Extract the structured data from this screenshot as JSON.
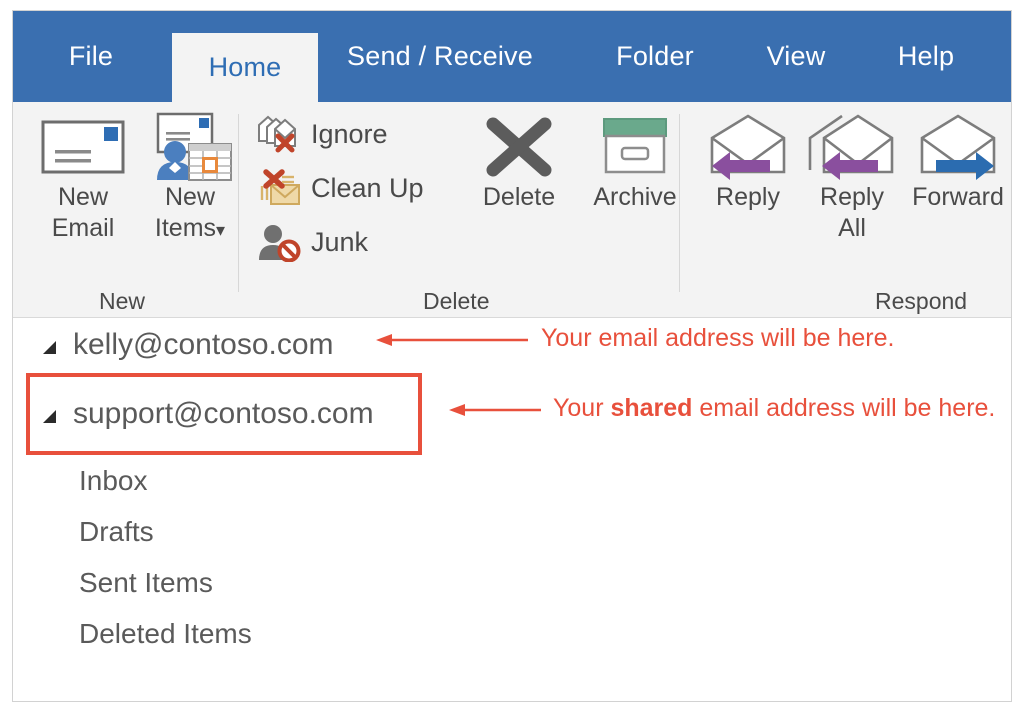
{
  "window": {
    "app": "Outlook"
  },
  "ribbon": {
    "tabs": [
      {
        "label": "File",
        "active": false
      },
      {
        "label": "Home",
        "active": true
      },
      {
        "label": "Send / Receive",
        "active": false
      },
      {
        "label": "Folder",
        "active": false
      },
      {
        "label": "View",
        "active": false
      },
      {
        "label": "Help",
        "active": false
      }
    ],
    "groups": [
      {
        "name": "New",
        "label": "New"
      },
      {
        "name": "Delete",
        "label": "Delete"
      },
      {
        "name": "Respond",
        "label": "Respond"
      }
    ],
    "commands": {
      "new_email": "New\nEmail",
      "new_email_line1": "New",
      "new_email_line2": "Email",
      "new_items_line1": "New",
      "new_items_line2": "Items",
      "new_items_caret": "▾",
      "ignore": "Ignore",
      "clean_up": "Clean Up",
      "junk": "Junk",
      "delete": "Delete",
      "archive": "Archive",
      "reply": "Reply",
      "reply_all_line1": "Reply",
      "reply_all_line2": "All",
      "forward": "Forward"
    },
    "icons": {
      "new_email": "envelope-icon",
      "new_items": "new-items-icon",
      "ignore": "ignore-icon",
      "clean_up": "clean-up-icon",
      "junk": "junk-icon",
      "delete": "delete-x-icon",
      "archive": "archive-box-icon",
      "reply": "reply-arrow-icon",
      "reply_all": "reply-all-arrow-icon",
      "forward": "forward-arrow-icon"
    }
  },
  "folder_pane": {
    "accounts": [
      {
        "address": "kelly@contoso.com",
        "expanded": true,
        "highlighted": false
      },
      {
        "address": "support@contoso.com",
        "expanded": true,
        "highlighted": true
      }
    ],
    "folders": [
      "Inbox",
      "Drafts",
      "Sent Items",
      "Deleted Items"
    ]
  },
  "annotations": [
    {
      "text_prefix": "Your email address will be here.",
      "text_bold": "",
      "text_suffix": ""
    },
    {
      "text_prefix": "Your ",
      "text_bold": "shared",
      "text_suffix": " email address will be here."
    }
  ],
  "colors": {
    "ribbon_blue": "#3a6fb0",
    "active_tab_text": "#2e6db4",
    "ribbon_bg": "#f3f3f3",
    "annotation_red": "#e8503c",
    "text_gray": "#5a5a5a",
    "archive_green": "#6aa98c",
    "reply_purple": "#8a4f9e",
    "forward_blue": "#2b6cb0"
  }
}
